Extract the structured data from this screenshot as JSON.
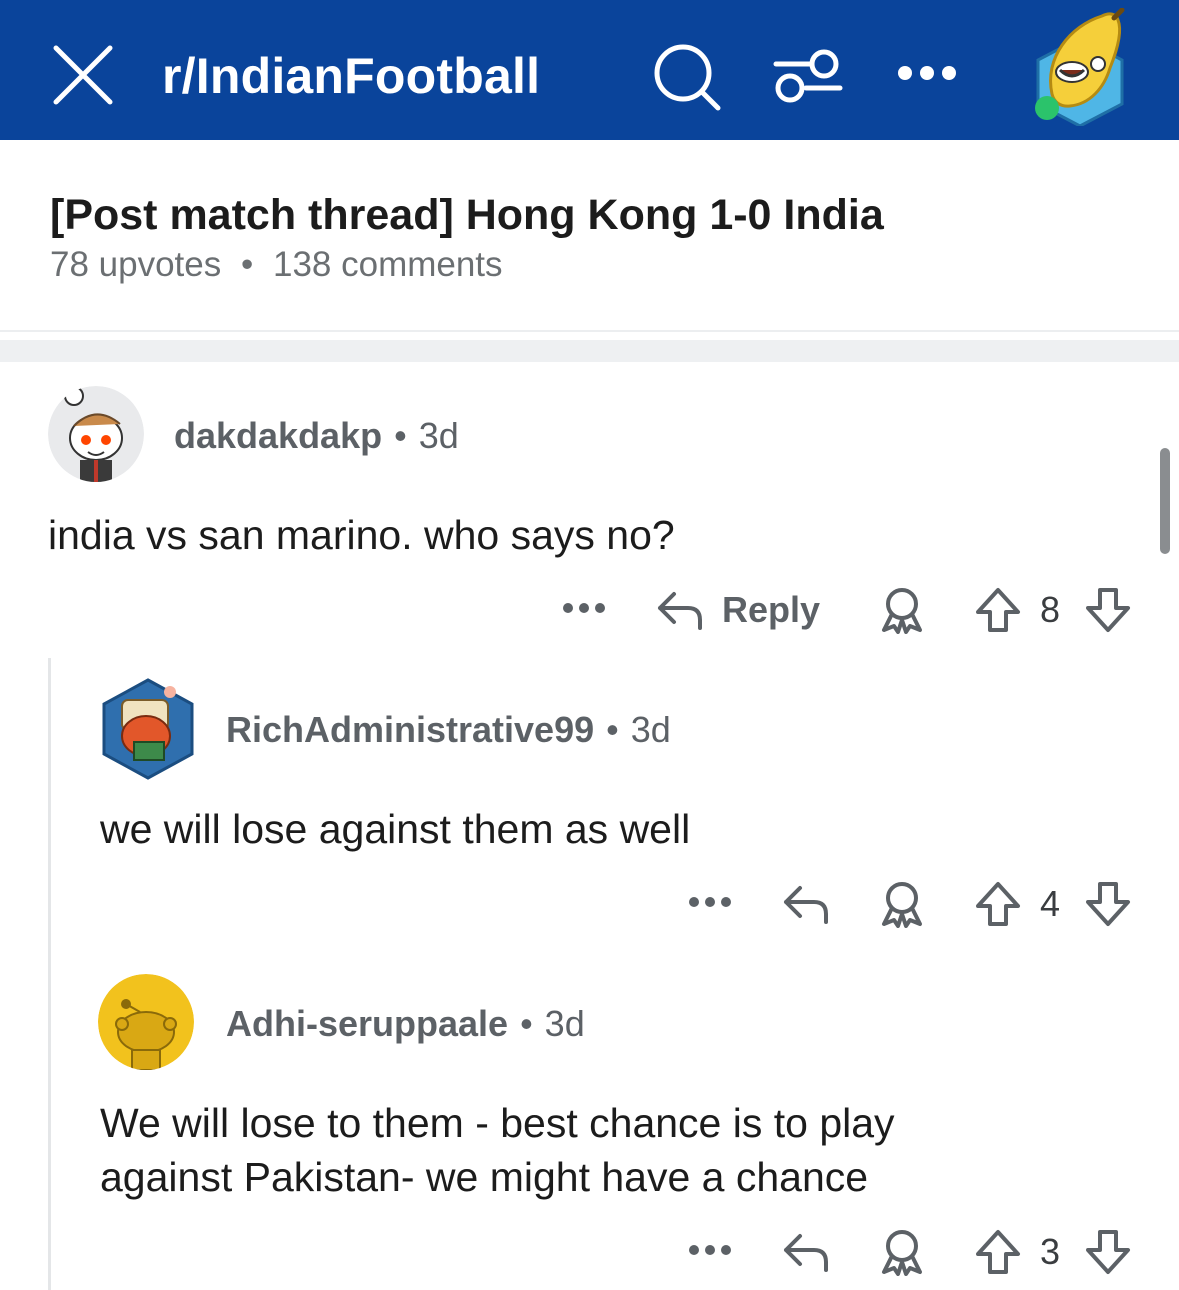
{
  "header": {
    "subreddit": "r/IndianFootball",
    "bg_color": "#0a449b",
    "icons": [
      "close-icon",
      "search-icon",
      "filter-icon",
      "more-icon",
      "user-avatar"
    ]
  },
  "post": {
    "title": "[Post match thread] Hong Kong 1-0 India",
    "upvotes": "78 upvotes",
    "comments": "138 comments",
    "separator": "•"
  },
  "comments": [
    {
      "username": "dakdakdakp",
      "age": "3d",
      "text": "india vs san marino. who says no?",
      "reply_label": "Reply",
      "score": "8"
    },
    {
      "username": "RichAdministrative99",
      "age": "3d",
      "text": "we will lose against them as well",
      "score": "4"
    },
    {
      "username": "Adhi-seruppaale",
      "age": "3d",
      "text": "We will lose to them - best chance is to play against Pakistan- we might have a chance",
      "score": "3"
    }
  ]
}
